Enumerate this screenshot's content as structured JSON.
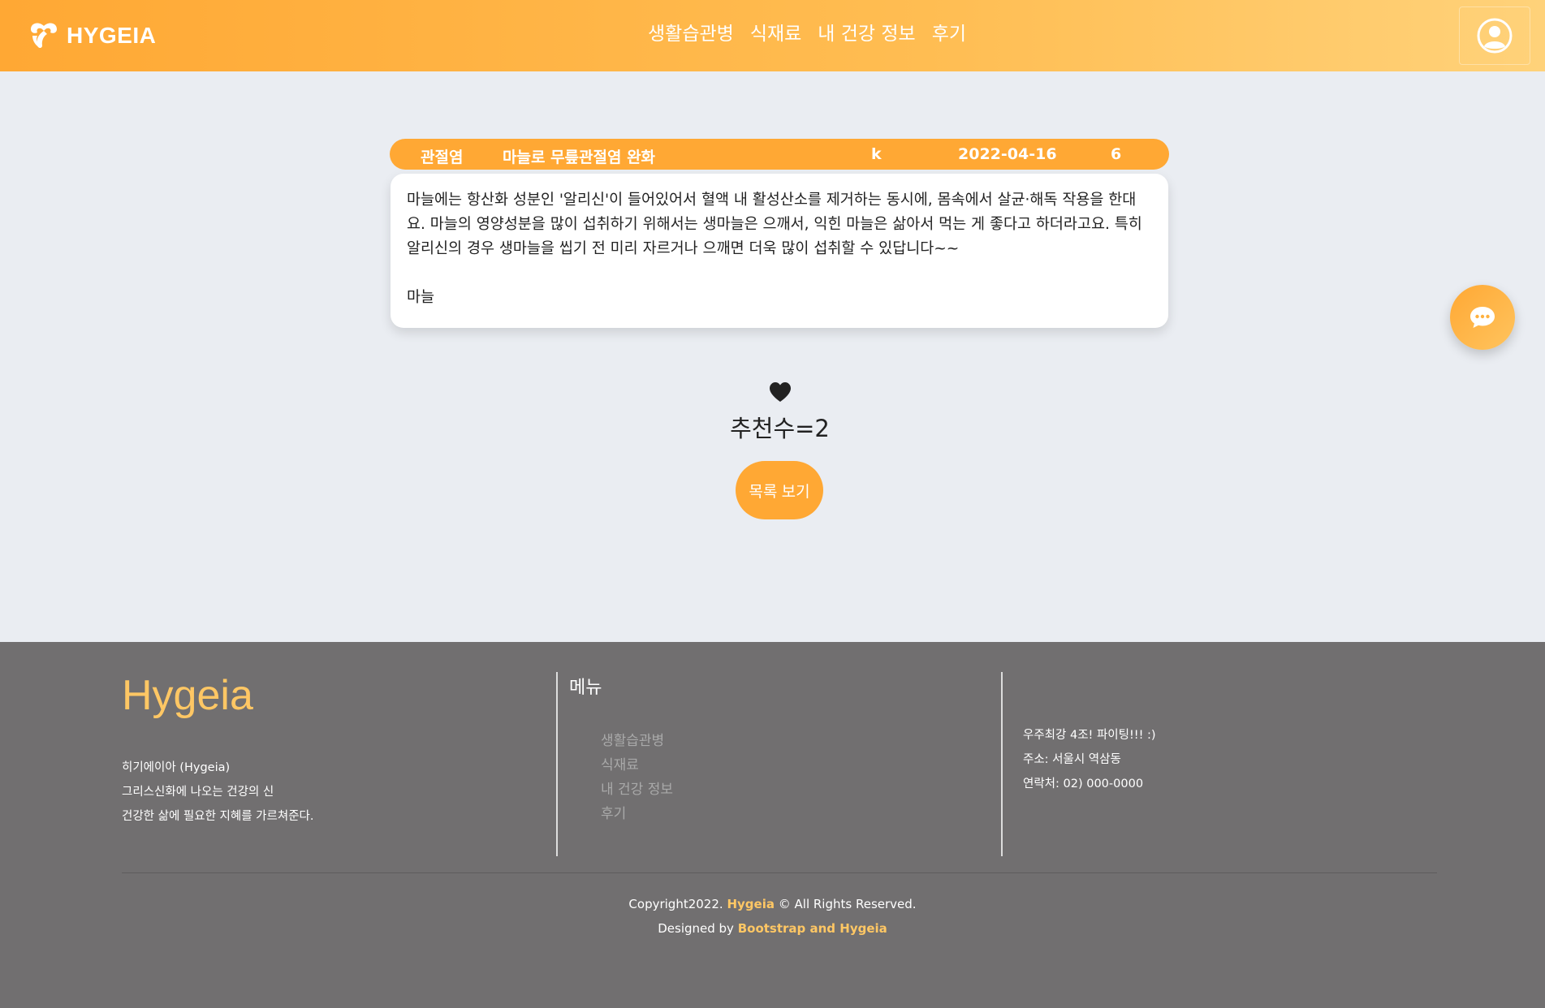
{
  "header": {
    "logo_text": "HYGEIA",
    "nav": [
      "생활습관병",
      "식재료",
      "내 건강 정보",
      "후기"
    ]
  },
  "post": {
    "category": "관절염",
    "title": "마늘로 무릎관절염 완화",
    "author": "k",
    "date": "2022-04-16",
    "views": "6",
    "content": "마늘에는 항산화 성분인 '알리신'이 들어있어서 혈액 내 활성산소를 제거하는 동시에, 몸속에서 살균·해독 작용을 한대요. 마늘의 영양성분을 많이 섭취하기 위해서는 생마늘은 으깨서, 익힌 마늘은 삶아서 먹는 게 좋다고 하더라고요. 특히 알리신의 경우 생마늘을 씹기 전 미리 자르거나 으깨면 더욱 많이 섭취할 수 있답니다~~",
    "tag": "마늘"
  },
  "recommend": {
    "label": "추천수=2",
    "list_button": "목록 보기"
  },
  "footer": {
    "brand": "Hygeia",
    "desc": [
      "히기에이아 (Hygeia)",
      "그리스신화에 나오는 건강의 신",
      "건강한 삶에 필요한 지혜를 가르쳐준다."
    ],
    "menu_title": "메뉴",
    "menu": [
      "생활습관병",
      "식재료",
      "내 건강 정보",
      "후기"
    ],
    "info": [
      "우주최강 4조! 파이팅!!! :)",
      "주소: 서울시 역삼동",
      "연락처: 02) 000-0000"
    ],
    "copy_prefix": "Copyright2022.",
    "copy_brand": "Hygeia",
    "copy_suffix": "© All Rights Reserved.",
    "designed_prefix": "Designed by",
    "designed_by": "Bootstrap and Hygeia"
  },
  "colors": {
    "accent": "#ffa834",
    "footer_bg": "#716f70",
    "footer_highlight": "#ffc764"
  }
}
